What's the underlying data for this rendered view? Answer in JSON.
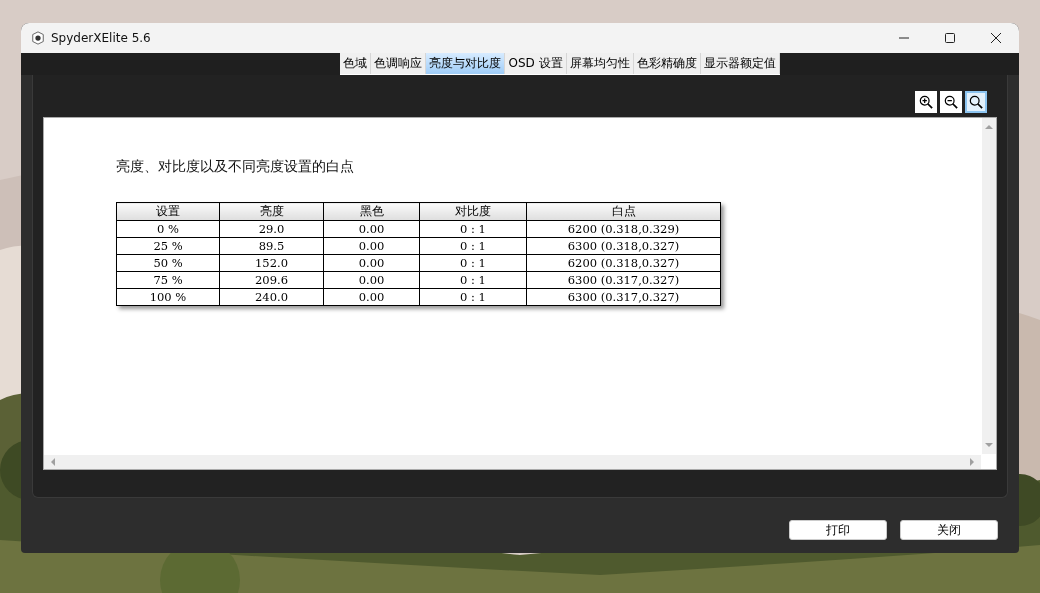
{
  "window": {
    "title": "SpyderXElite 5.6"
  },
  "tabs": [
    {
      "label": "色域",
      "selected": false
    },
    {
      "label": "色调响应",
      "selected": false
    },
    {
      "label": "亮度与对比度",
      "selected": true
    },
    {
      "label": "OSD 设置",
      "selected": false
    },
    {
      "label": "屏幕均匀性",
      "selected": false
    },
    {
      "label": "色彩精确度",
      "selected": false
    },
    {
      "label": "显示器额定值",
      "selected": false
    }
  ],
  "zoom_tools": [
    {
      "kind": "zoom-in",
      "selected": false
    },
    {
      "kind": "zoom-out",
      "selected": false
    },
    {
      "kind": "zoom-fit",
      "selected": true
    }
  ],
  "report": {
    "heading": "亮度、对比度以及不同亮度设置的白点",
    "table": {
      "columns": [
        "设置",
        "亮度",
        "黑色",
        "对比度",
        "白点"
      ],
      "rows": [
        [
          "0 %",
          "29.0",
          "0.00",
          "0 : 1",
          "6200 (0.318,0.329)"
        ],
        [
          "25 %",
          "89.5",
          "0.00",
          "0 : 1",
          "6300 (0.318,0.327)"
        ],
        [
          "50 %",
          "152.0",
          "0.00",
          "0 : 1",
          "6200 (0.318,0.327)"
        ],
        [
          "75 %",
          "209.6",
          "0.00",
          "0 : 1",
          "6300 (0.317,0.327)"
        ],
        [
          "100 %",
          "240.0",
          "0.00",
          "0 : 1",
          "6300 (0.317,0.327)"
        ]
      ]
    }
  },
  "buttons": [
    "打印",
    "关闭"
  ]
}
